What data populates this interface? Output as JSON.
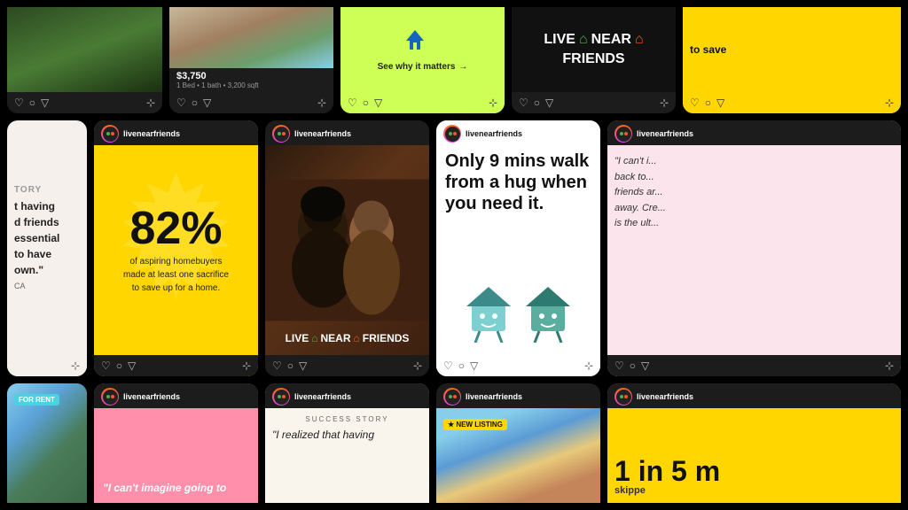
{
  "app": {
    "background": "#000000"
  },
  "rows": {
    "row1": {
      "cards": [
        {
          "id": "r1c1",
          "type": "partial-top",
          "bg": "landscape",
          "has_footer": true,
          "footer_icons": [
            "heart",
            "comment",
            "share",
            "bookmark"
          ]
        },
        {
          "id": "r1c2",
          "type": "property",
          "bg": "house-exterior",
          "price": "$3,750",
          "details": "1 Bed • 1 bath • 3,200 sqft",
          "has_footer": true,
          "footer_icons": [
            "heart",
            "comment",
            "share",
            "bookmark"
          ]
        },
        {
          "id": "r1c3",
          "type": "lime",
          "bg": "#CDFF57",
          "text": "See why it matters",
          "arrow": "→",
          "has_footer": true,
          "footer_icons": [
            "heart",
            "comment",
            "share",
            "bookmark"
          ]
        },
        {
          "id": "r1c4",
          "type": "live-near",
          "bg": "#222",
          "text": "LIVE NEAR FRIENDS",
          "has_footer": true,
          "footer_icons": [
            "heart",
            "comment",
            "share",
            "bookmark"
          ]
        },
        {
          "id": "r1c5",
          "type": "yellow-partial",
          "bg": "#FFD700",
          "text": "to save",
          "has_footer": true,
          "footer_icons": [
            "heart",
            "comment",
            "share",
            "bookmark"
          ]
        }
      ]
    },
    "row2": {
      "cards": [
        {
          "id": "r2c1",
          "type": "quote-partial",
          "bg": "#f5f0eb",
          "lines": [
            "t having",
            "d friends",
            "essential",
            "to have",
            "own.\"",
            "CA"
          ],
          "has_header": false,
          "has_footer": true,
          "footer_icons": [
            "bookmark"
          ]
        },
        {
          "id": "r2c2",
          "type": "stat",
          "username": "livenearfriends",
          "bg": "#FFD600",
          "stat": "82%",
          "subtext": "of aspiring homebuyers\nmade at least one sacrifice\nto save up for a home.",
          "has_header": true,
          "has_footer": true,
          "footer_icons": [
            "heart",
            "comment",
            "share",
            "bookmark"
          ]
        },
        {
          "id": "r2c3",
          "type": "photo",
          "username": "livenearfriends",
          "bg": "people",
          "overlay": "LIVE NEAR FRIENDS",
          "has_header": true,
          "has_footer": true,
          "footer_icons": [
            "heart",
            "comment",
            "share",
            "bookmark"
          ]
        },
        {
          "id": "r2c4",
          "type": "walk",
          "username": "livenearfriends",
          "bg": "#fff",
          "headline": "Only 9 mins walk from a hug when you need it.",
          "has_header": true,
          "has_footer": true,
          "footer_icons": [
            "heart",
            "comment",
            "share",
            "bookmark"
          ]
        },
        {
          "id": "r2c5",
          "type": "quote-partial-right",
          "username": "livenearfriends",
          "bg": "#fce4ec",
          "quote_lines": [
            "\"I can't i...",
            "back to...",
            "friends ar...",
            "away. Cre...",
            "is the ult..."
          ],
          "has_header": true,
          "has_footer": true,
          "footer_icons": [
            "heart",
            "comment",
            "share",
            "bookmark"
          ]
        }
      ]
    },
    "row3": {
      "cards": [
        {
          "id": "r3c1",
          "type": "for-rent",
          "bg": "outdoor",
          "badge": "FOR RENT",
          "has_footer": false
        },
        {
          "id": "r3c2",
          "type": "pink-imagine",
          "username": "livenearfriends",
          "bg": "#FF8FAB",
          "quote": "\"I can't imagine going to",
          "has_header": true,
          "has_footer": false
        },
        {
          "id": "r3c3",
          "type": "success",
          "username": "livenearfriends",
          "bg": "#f9f5ed",
          "label": "SUCCESS STORY",
          "quote": "\"I realized that having",
          "has_header": true,
          "has_footer": false
        },
        {
          "id": "r3c4",
          "type": "new-listing",
          "username": "livenearfriends",
          "bg": "city",
          "badge": "★ NEW LISTING",
          "has_header": true,
          "has_footer": false
        },
        {
          "id": "r3c5",
          "type": "stat-partial",
          "username": "livenearfriends",
          "bg": "#FFD600",
          "stat": "1 in 5 m",
          "subtext": "skippe",
          "has_header": true,
          "has_footer": false
        }
      ]
    }
  },
  "icons": {
    "heart": "♡",
    "comment": "○",
    "share": "▽",
    "bookmark": "⊹"
  }
}
